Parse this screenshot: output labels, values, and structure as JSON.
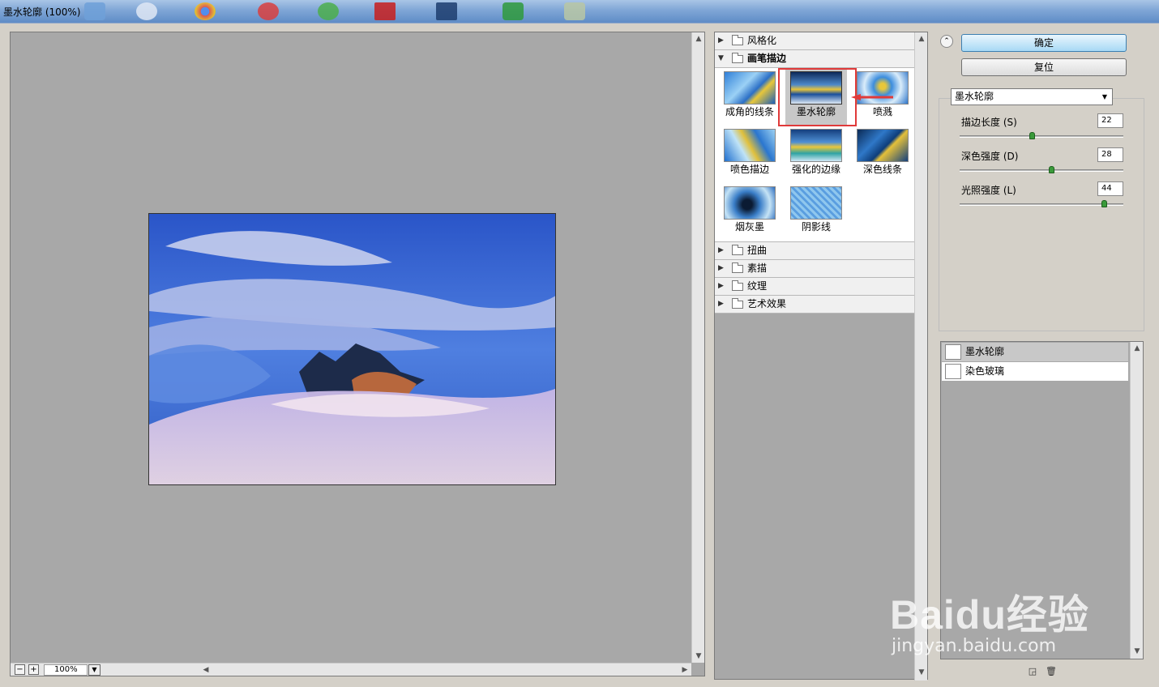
{
  "window": {
    "title": "墨水轮廓 (100%)"
  },
  "preview": {
    "zoom": "100%",
    "zoom_out": "−",
    "zoom_in": "+"
  },
  "filter_gallery": {
    "categories_top": [
      {
        "label": "风格化",
        "expanded": false
      },
      {
        "label": "画笔描边",
        "expanded": true
      }
    ],
    "brush_strokes": [
      {
        "label": "成角的线条",
        "selected": false
      },
      {
        "label": "墨水轮廓",
        "selected": true
      },
      {
        "label": "喷溅",
        "selected": false
      },
      {
        "label": "喷色描边",
        "selected": false
      },
      {
        "label": "强化的边缘",
        "selected": false
      },
      {
        "label": "深色线条",
        "selected": false
      },
      {
        "label": "烟灰墨",
        "selected": false
      },
      {
        "label": "阴影线",
        "selected": false
      }
    ],
    "categories_bottom": [
      {
        "label": "扭曲",
        "expanded": false
      },
      {
        "label": "素描",
        "expanded": false
      },
      {
        "label": "纹理",
        "expanded": false
      },
      {
        "label": "艺术效果",
        "expanded": false
      }
    ]
  },
  "settings": {
    "ok_label": "确定",
    "reset_label": "复位",
    "filter_select": "墨水轮廓",
    "params": [
      {
        "label": "描边长度 (S)",
        "value": "22",
        "fraction": 0.44
      },
      {
        "label": "深色强度 (D)",
        "value": "28",
        "fraction": 0.56
      },
      {
        "label": "光照强度 (L)",
        "value": "44",
        "fraction": 0.88
      }
    ]
  },
  "effect_layers": [
    {
      "label": "墨水轮廓",
      "active": true
    },
    {
      "label": "染色玻璃",
      "active": false
    }
  ],
  "watermark": {
    "logo": "Baidu经验",
    "url": "jingyan.baidu.com"
  },
  "colors": {
    "highlight_box": "#e03a3a",
    "slider_thumb": "#3a9a3a",
    "primary_button": "#a7d9f5"
  }
}
